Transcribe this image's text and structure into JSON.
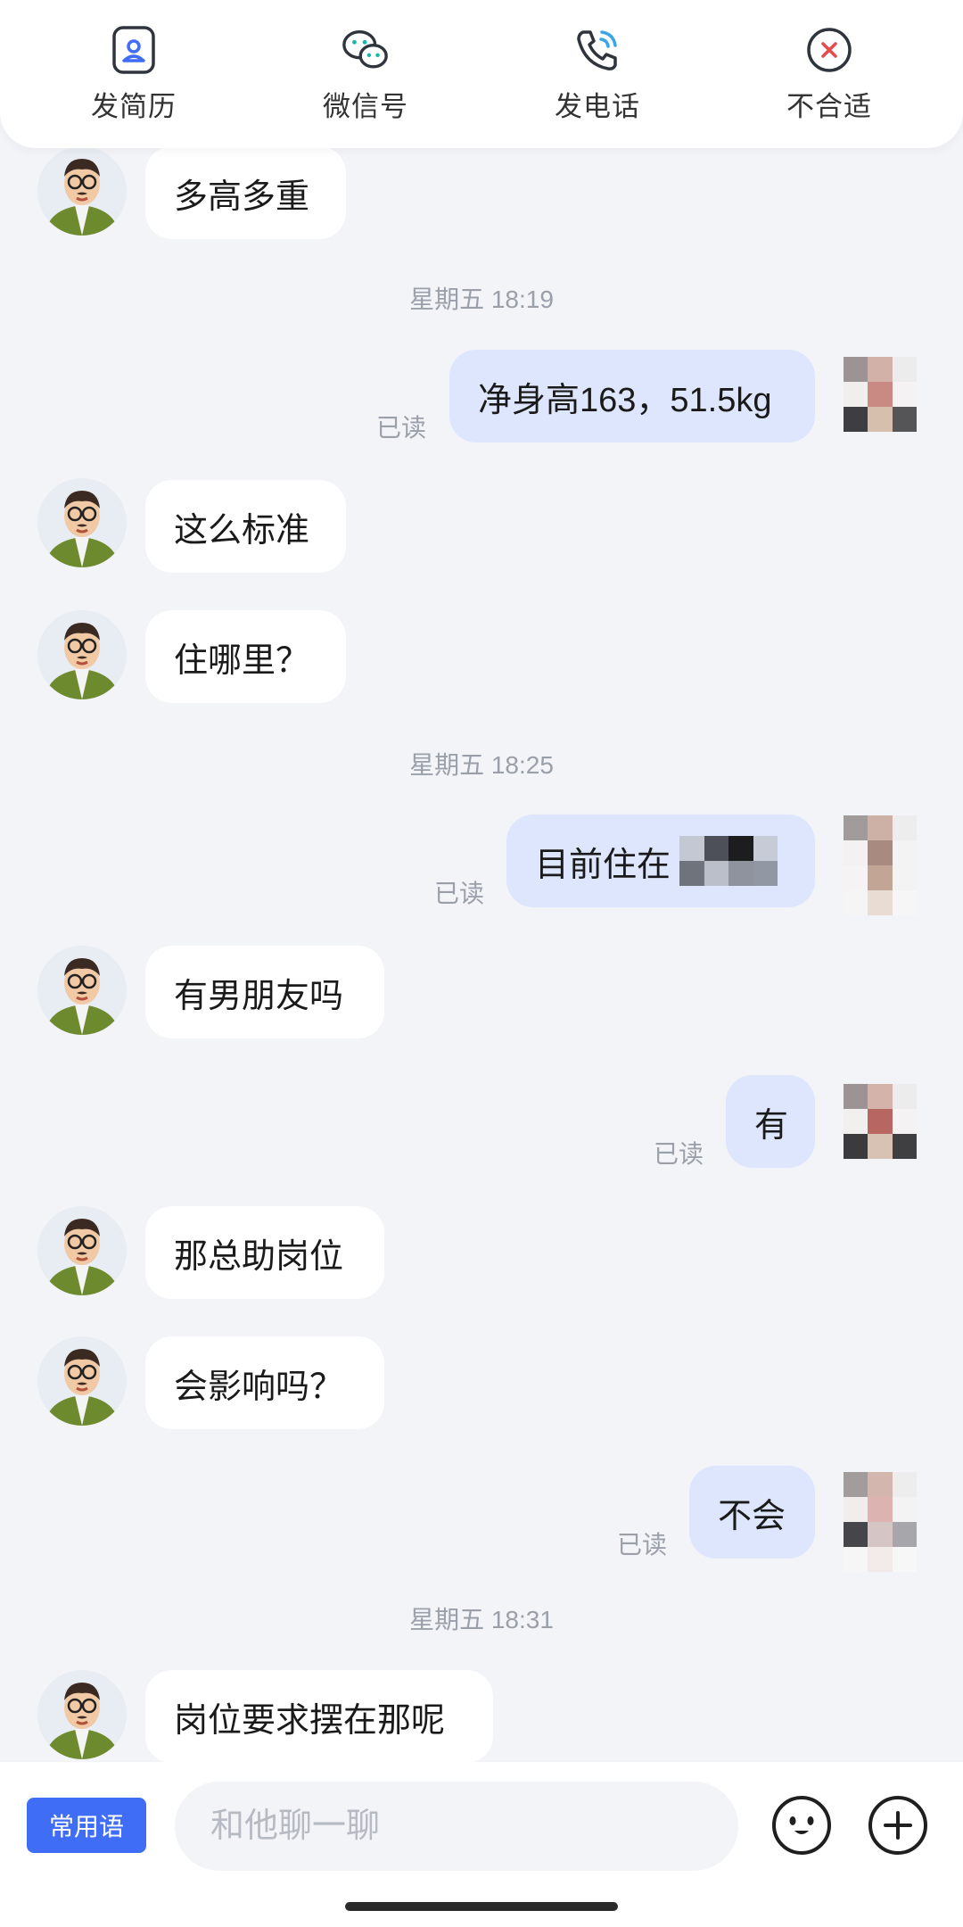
{
  "actions": [
    {
      "label": "发简历",
      "icon": "resume-icon"
    },
    {
      "label": "微信号",
      "icon": "wechat-icon"
    },
    {
      "label": "发电话",
      "icon": "phone-icon"
    },
    {
      "label": "不合适",
      "icon": "close-circle-icon"
    }
  ],
  "messages": {
    "m1": "多高多重",
    "t1": "星期五 18:19",
    "m2": "净身高163，51.5kg",
    "m3": "这么标准",
    "m4": "住哪里？",
    "t2": "星期五 18:25",
    "m5": "目前住在",
    "m6": "有男朋友吗",
    "m7": "有",
    "m8": "那总助岗位",
    "m9": "会影响吗？",
    "m10": "不会",
    "t3": "星期五 18:31",
    "m11": "岗位要求摆在那呢"
  },
  "read_label": "已读",
  "input": {
    "quick_phrases": "常用语",
    "placeholder": "和他聊一聊"
  },
  "colors": {
    "accent": "#3f6df5",
    "outgoing_bubble": "#dde6fd",
    "incoming_bubble": "#ffffff",
    "background": "#f3f4f8"
  }
}
